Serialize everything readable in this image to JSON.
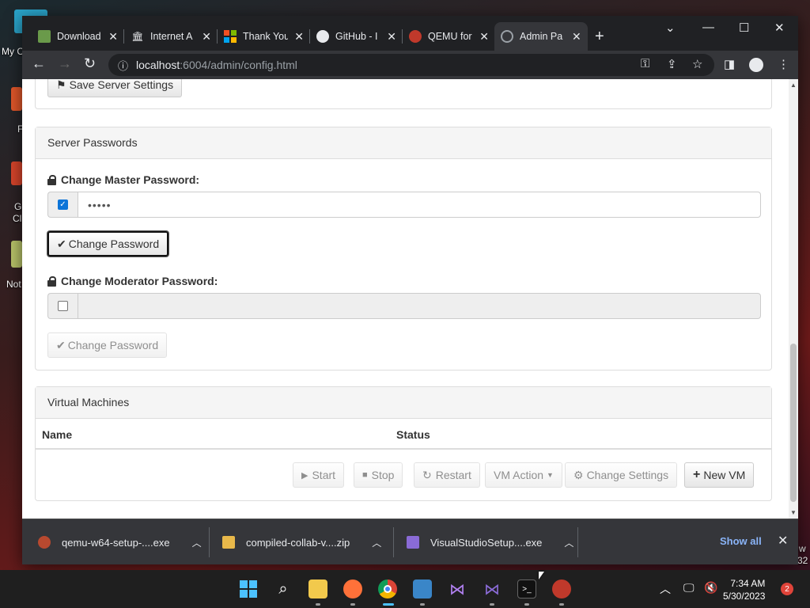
{
  "desktop": {
    "labels": [
      "My C",
      "F",
      "G",
      "Cl",
      "Not",
      "w",
      "32"
    ]
  },
  "tabs": [
    {
      "title": "Download",
      "icon": "package-icon",
      "color": "#6a9a4a"
    },
    {
      "title": "Internet A",
      "icon": "archive-icon",
      "color": "#e8eaed"
    },
    {
      "title": "Thank You",
      "icon": "microsoft-icon",
      "color": "#f25022"
    },
    {
      "title": "GitHub - I",
      "icon": "github-icon",
      "color": "#e8eaed"
    },
    {
      "title": "QEMU for",
      "icon": "qemu-icon",
      "color": "#c0392b"
    },
    {
      "title": "Admin Pa",
      "icon": "globe-icon",
      "color": "#9aa0a6"
    }
  ],
  "address": {
    "host": "localhost",
    "path": ":6004/admin/config.html"
  },
  "page": {
    "save_server_settings": "Save Server Settings",
    "server_passwords_heading": "Server Passwords",
    "master_label": "Change Master Password:",
    "master_value": "•••••",
    "change_password": "Change Password",
    "moderator_label": "Change Moderator Password:",
    "moderator_value": "",
    "vm_heading": "Virtual Machines",
    "columns": [
      "Name",
      "Status"
    ],
    "actions": {
      "start": "Start",
      "stop": "Stop",
      "restart": "Restart",
      "vm_action": "VM Action",
      "change_settings": "Change Settings",
      "new_vm": "New VM"
    }
  },
  "downloads": [
    {
      "name": "qemu-w64-setup-....exe",
      "color": "#b8492f"
    },
    {
      "name": "compiled-collab-v....zip",
      "color": "#e8b84a"
    },
    {
      "name": "VisualStudioSetup....exe",
      "color": "#8a6bd6"
    }
  ],
  "downloads_bar": {
    "show_all": "Show all"
  },
  "taskbar": {
    "time": "7:34 AM",
    "date": "5/30/2023",
    "notifications": "2"
  },
  "colors": {
    "accent": "#0b74d8",
    "link": "#8ab4f8",
    "badge": "#e0443a"
  }
}
